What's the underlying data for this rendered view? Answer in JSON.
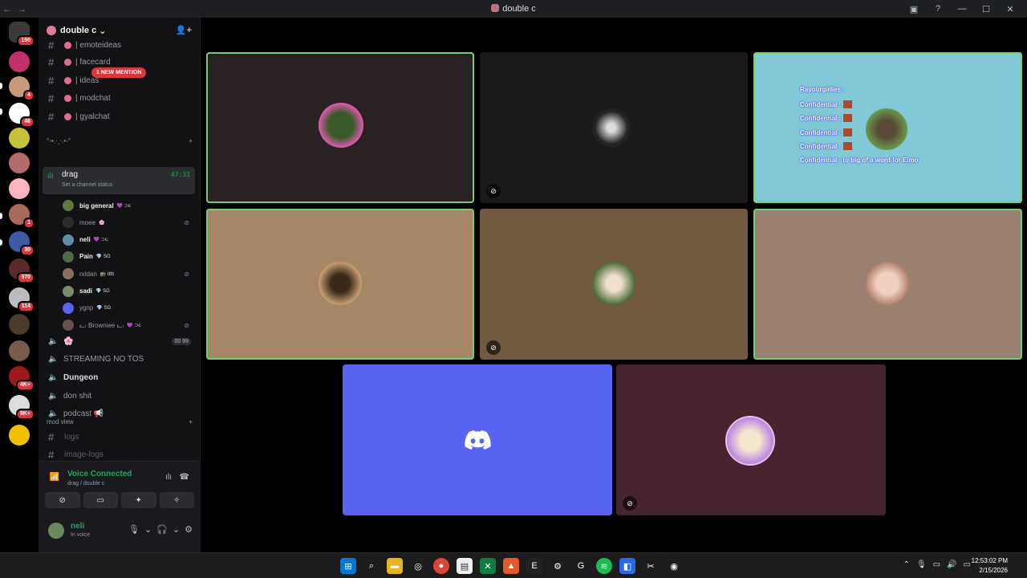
{
  "window": {
    "title": "double c"
  },
  "guilds": [
    {
      "color": "#3a3a3a",
      "badge": "150"
    },
    {
      "color": "#c0306a",
      "badge": ""
    },
    {
      "color": "#c99a7a",
      "badge": "4"
    },
    {
      "color": "#ffffff",
      "badge": "46"
    },
    {
      "color": "#c6c23a",
      "badge": ""
    },
    {
      "color": "#b56a6a",
      "badge": ""
    },
    {
      "color": "#ffb3c1",
      "badge": ""
    },
    {
      "color": "#a86b5a",
      "badge": "1"
    },
    {
      "color": "#3d5aa3",
      "badge": "30"
    },
    {
      "color": "#5a2a2a",
      "badge": "370"
    },
    {
      "color": "#bcbcbc",
      "badge": "114"
    },
    {
      "color": "#4a3b2a",
      "badge": ""
    },
    {
      "color": "#7a5a4a",
      "badge": ""
    },
    {
      "color": "#a01818",
      "badge": "4K+"
    },
    {
      "color": "#dddddd",
      "badge": "9K+"
    },
    {
      "color": "#f0c000",
      "badge": ""
    }
  ],
  "server": {
    "name": "double c"
  },
  "mention_banner": "1 NEW MENTION",
  "text_channels": [
    {
      "name": "emoteideas"
    },
    {
      "name": "facecard"
    },
    {
      "name": "ideas"
    },
    {
      "name": "modchat"
    },
    {
      "name": "gyalchat"
    }
  ],
  "category_voice": "°◦•.·˳·.•◦°",
  "active_voice": {
    "name": "drag",
    "status": "Set a channel status",
    "timer": "47:33"
  },
  "voice_users": [
    {
      "name": "big general",
      "tag": "💜 ⊃c",
      "bright": true,
      "muted": false,
      "color": "#5e7a3c"
    },
    {
      "name": "moee",
      "tag": "🌸",
      "bright": false,
      "muted": true,
      "color": "#2d2d2d"
    },
    {
      "name": "neli",
      "tag": "💜 ⊃c",
      "bright": true,
      "muted": false,
      "color": "#5c8ea8"
    },
    {
      "name": "Pain",
      "tag": "💎 SG",
      "bright": true,
      "muted": false,
      "color": "#4f6b4a"
    },
    {
      "name": "rxldan",
      "tag": "🕋 dtb",
      "bright": false,
      "muted": true,
      "color": "#8a7060"
    },
    {
      "name": "sadi",
      "tag": "💎 SG",
      "bright": true,
      "muted": false,
      "color": "#7a8a6a"
    },
    {
      "name": "ygnp",
      "tag": "💎 SG",
      "bright": false,
      "muted": false,
      "color": "#5865f2"
    },
    {
      "name": "ᓚ₍ Browniee ᓚ₍",
      "tag": "💜 ⊃c",
      "bright": false,
      "muted": true,
      "color": "#6a5050"
    }
  ],
  "voice_channels": [
    {
      "name": "🌸",
      "counter": "00  99",
      "bold": false
    },
    {
      "name": "STREAMING NO TOS",
      "counter": "",
      "bold": false
    },
    {
      "name": "Dungeon",
      "counter": "",
      "bold": true
    },
    {
      "name": "don shit",
      "counter": "",
      "bold": false
    },
    {
      "name": "podcast 📢",
      "counter": "",
      "bold": false
    }
  ],
  "category_mod": "mod view",
  "mod_channels": [
    {
      "name": "logs"
    },
    {
      "name": "image-logs"
    }
  ],
  "voice_panel": {
    "status": "Voice Connected",
    "sub": "drag / double c"
  },
  "me": {
    "name": "neli",
    "status": "In voice"
  },
  "caption": {
    "header": "Rayourgirlies :",
    "lines": [
      "Confidential :",
      "Confidential :",
      "Confidential :",
      "Confidential :"
    ],
    "last_label": "Confidential :",
    "last_text": "to big of a word for Elmo"
  },
  "clock": {
    "time": "12:53:02 PM",
    "date": "2/15/2026"
  },
  "colors": {
    "accent_green": "#23a55a",
    "speaking": "#6fd16f",
    "blurple": "#5865f2"
  }
}
